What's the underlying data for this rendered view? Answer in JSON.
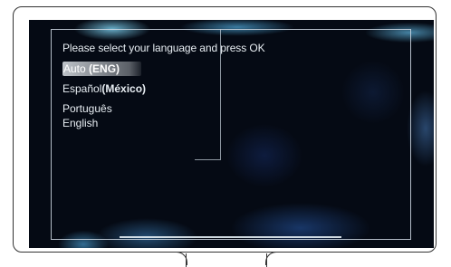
{
  "screen": {
    "prompt": "Please select your language and press OK",
    "languages": [
      {
        "name": "Auto",
        "code": "(ENG)",
        "selected": true
      },
      {
        "name": "Español",
        "code": "(México)",
        "selected": false
      },
      {
        "name": "Português",
        "code": "",
        "selected": false
      },
      {
        "name": "English",
        "code": "",
        "selected": false
      }
    ]
  },
  "colors": {
    "background": "#050a14",
    "text": "#e8eef3",
    "highlight": "#d2d7dc"
  }
}
